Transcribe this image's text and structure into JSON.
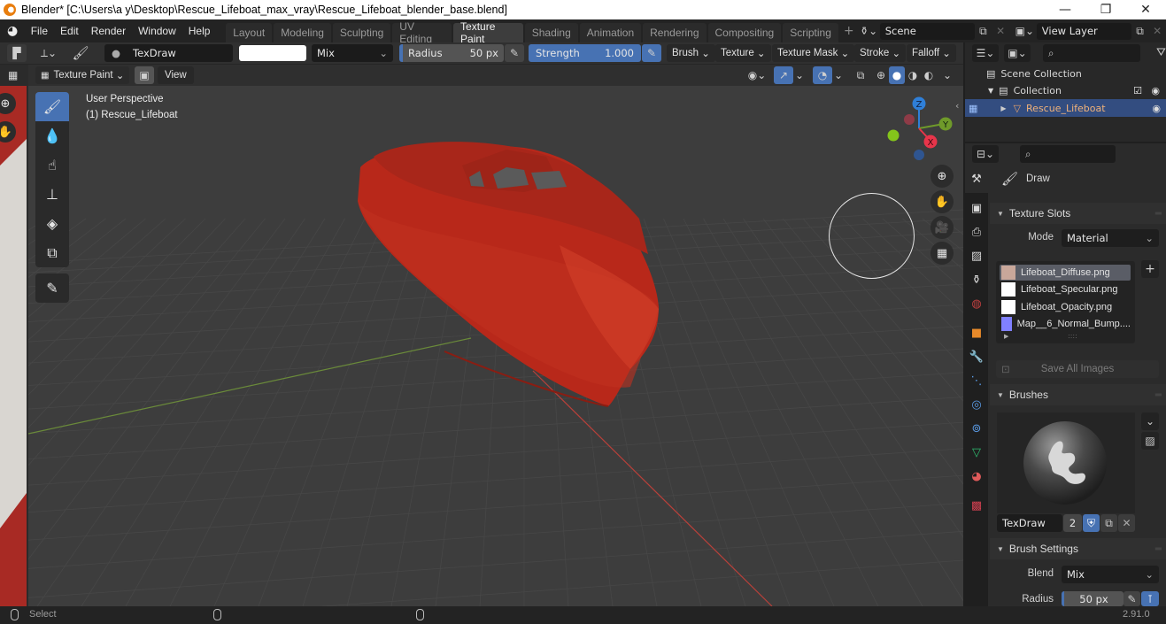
{
  "window": {
    "title": "Blender* [C:\\Users\\a y\\Desktop\\Rescue_Lifeboat_max_vray\\Rescue_Lifeboat_blender_base.blend]",
    "controls": {
      "minimize": "—",
      "maximize": "❐",
      "close": "✕"
    }
  },
  "menu": [
    "File",
    "Edit",
    "Render",
    "Window",
    "Help"
  ],
  "workspaces": {
    "tabs": [
      "Layout",
      "Modeling",
      "Sculpting",
      "UV Editing",
      "Texture Paint",
      "Shading",
      "Animation",
      "Rendering",
      "Compositing",
      "Scripting"
    ],
    "active": "Texture Paint",
    "add_label": "+"
  },
  "scene": {
    "name": "Scene",
    "view_layer": "View Layer"
  },
  "tool_header": {
    "brush_name": "TexDraw",
    "color_hex": "#ffffff",
    "blend": "Mix",
    "radius_label": "Radius",
    "radius_value": "50 px",
    "strength_label": "Strength",
    "strength_value": "1.000",
    "strength_fraction": 1.0,
    "menus": [
      "Brush",
      "Texture",
      "Texture Mask",
      "Stroke",
      "Falloff"
    ]
  },
  "viewport_header": {
    "mode": "Texture Paint",
    "view_label": "View"
  },
  "viewport": {
    "perspective": "User Perspective",
    "object_label": "(1) Rescue_Lifeboat",
    "gizmo_axes": {
      "z": "Z",
      "y": "Y",
      "x": "X"
    },
    "axis_colors": {
      "x": "#e8354a",
      "y": "#6f9a2a",
      "z": "#2f7fd8"
    },
    "model_color": "#b8281a"
  },
  "toolshelf": [
    {
      "name": "draw",
      "icon": "paint-brush-icon",
      "active": true
    },
    {
      "name": "soften",
      "icon": "drop-icon"
    },
    {
      "name": "smear",
      "icon": "smear-icon"
    },
    {
      "name": "clone",
      "icon": "stamp-icon"
    },
    {
      "name": "fill",
      "icon": "bucket-icon"
    },
    {
      "name": "mask",
      "icon": "mask-icon"
    },
    {
      "name": "annotate",
      "icon": "annotate-pencil-icon"
    }
  ],
  "outliner": {
    "items": [
      {
        "label": "Scene Collection",
        "level": 0
      },
      {
        "label": "Collection",
        "level": 1
      },
      {
        "label": "Rescue_Lifeboat",
        "level": 2,
        "selected": true
      }
    ]
  },
  "properties": {
    "active_tool": "Draw",
    "texture_slots": {
      "title": "Texture Slots",
      "mode_label": "Mode",
      "mode_value": "Material",
      "slots": [
        {
          "name": "Lifeboat_Diffuse.png",
          "swatch": "#c9a79a",
          "active": true
        },
        {
          "name": "Lifeboat_Specular.png",
          "swatch": "#ffffff"
        },
        {
          "name": "Lifeboat_Opacity.png",
          "swatch": "#ffffff"
        },
        {
          "name": "Map__6_Normal_Bump....",
          "swatch": "#8080ff"
        }
      ],
      "add_label": "+",
      "save_all_label": "Save All Images"
    },
    "brushes": {
      "title": "Brushes",
      "brush_name": "TexDraw",
      "users": "2"
    },
    "brush_settings": {
      "title": "Brush Settings",
      "blend_label": "Blend",
      "blend_value": "Mix",
      "radius_label": "Radius",
      "radius_value": "50 px"
    }
  },
  "statusbar": {
    "left_action": "Select",
    "version": "2.91.0"
  }
}
